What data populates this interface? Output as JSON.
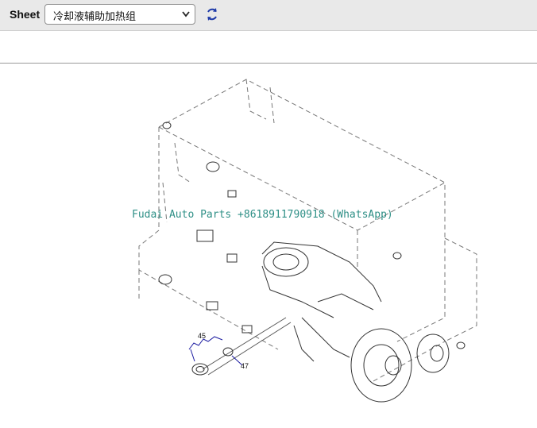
{
  "toolbar": {
    "sheet_label": "Sheet",
    "sheet_selected": "冷却液辅助加热组",
    "refresh_icon": "refresh-icon"
  },
  "diagram": {
    "watermark": "Fudai Auto Parts +8618911790918 (WhatsApp)",
    "callouts": [
      "45",
      "47"
    ],
    "accent_color": "#1a1aa0"
  }
}
